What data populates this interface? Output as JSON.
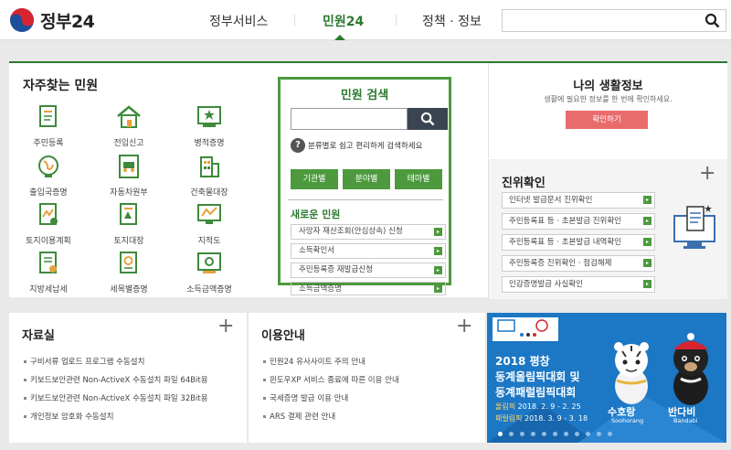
{
  "header": {
    "logo_text": "정부24",
    "nav": [
      "정부서비스",
      "민원24",
      "정책 · 정보"
    ]
  },
  "frequent": {
    "title": "자주찾는 민원",
    "items": [
      "주민등록",
      "전입신고",
      "병적증명",
      "출입국증명",
      "자동차원부",
      "건축물대장",
      "토지이용계획",
      "토지대장",
      "지적도",
      "지방세납세",
      "세목별증명",
      "소득금액증명"
    ]
  },
  "civil_search": {
    "title": "민원 검색",
    "hint": "분류별로 쉽고 편리하게 검색하세요",
    "categories": [
      "기관별",
      "분야별",
      "테마별"
    ],
    "new_title": "새로운 민원",
    "new_items": [
      "사망자 재산조회(안심상속) 신청",
      "소득확인서",
      "주민등록증 재발급신청",
      "소득금액증명"
    ]
  },
  "life": {
    "title": "나의 생활정보",
    "desc": "생활에 필요한 정보를 한 번에 확인하세요.",
    "button": "확인하기"
  },
  "verify": {
    "title": "진위확인",
    "items": [
      "인터넷 발급문서 진위확인",
      "주민등록표 등 · 초본발급 진위확인",
      "주민등록표 등 · 초본발급 내역확인",
      "주민등록증 진위확인 · 점검해제",
      "인감증명발급 사실확인"
    ]
  },
  "resources": {
    "title": "자료실",
    "items": [
      "구비서류 업로드 프로그램 수동설치",
      "키보드보안관련 Non-ActiveX 수동설치 파일 64Bit용",
      "키보드보안관련 Non-ActiveX 수동설치 파일 32Bit용",
      "개인정보 암호화 수동설치"
    ]
  },
  "guide": {
    "title": "이용안내",
    "items": [
      "민원24 유사사이트 주의 안내",
      "윈도우XP 서비스 종료에 따른 이용 안내",
      "국세증명 발급 이용 안내",
      "ARS 결제 관련 안내"
    ]
  },
  "banner": {
    "line1": "2018 평창",
    "line2": "동계올림픽대회 및",
    "line3": "동계패럴림픽대회",
    "olympic_label": "올림픽",
    "olympic_dates": "2018. 2. 9 - 2. 25",
    "paralympic_label": "패럴림픽",
    "paralympic_dates": "2018. 3. 9 - 3. 18",
    "mascot1": "수호랑",
    "mascot1_en": "Soohorang",
    "mascot2": "반다비",
    "mascot2_en": "Bandabi"
  },
  "colors": {
    "brand_green": "#2c7a2f",
    "button_green": "#4d9a3e",
    "life_button": "#e86c6c",
    "banner_blue": "#1c77c4"
  },
  "icons": [
    "taegeuk-logo",
    "search-icon",
    "question-icon",
    "plus-icon",
    "arrow-right-icon",
    "document-check-icon"
  ]
}
